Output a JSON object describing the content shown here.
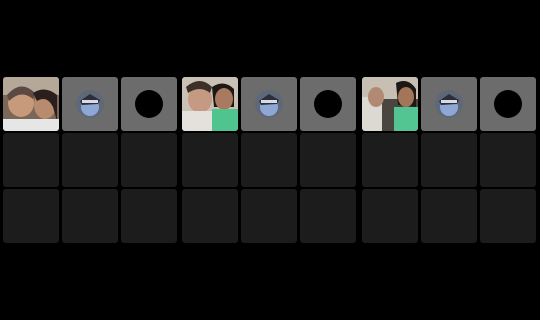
{
  "app": {
    "theme": "dark",
    "background": "#000000",
    "tile_color": "#1c1c1c",
    "active_tile_color": "#6c6c6c"
  },
  "panels": [
    {
      "id": "panel-1",
      "first_tile": "camera-photo",
      "second_tile": "emoji-sticker",
      "third_tile": "record-circle",
      "empty_rows": 2
    },
    {
      "id": "panel-2",
      "first_tile": "camera-photo",
      "second_tile": "emoji-sticker",
      "third_tile": "record-circle",
      "empty_rows": 2
    },
    {
      "id": "panel-3",
      "first_tile": "camera-photo",
      "second_tile": "emoji-sticker",
      "third_tile": "record-circle",
      "empty_rows": 2
    }
  ]
}
